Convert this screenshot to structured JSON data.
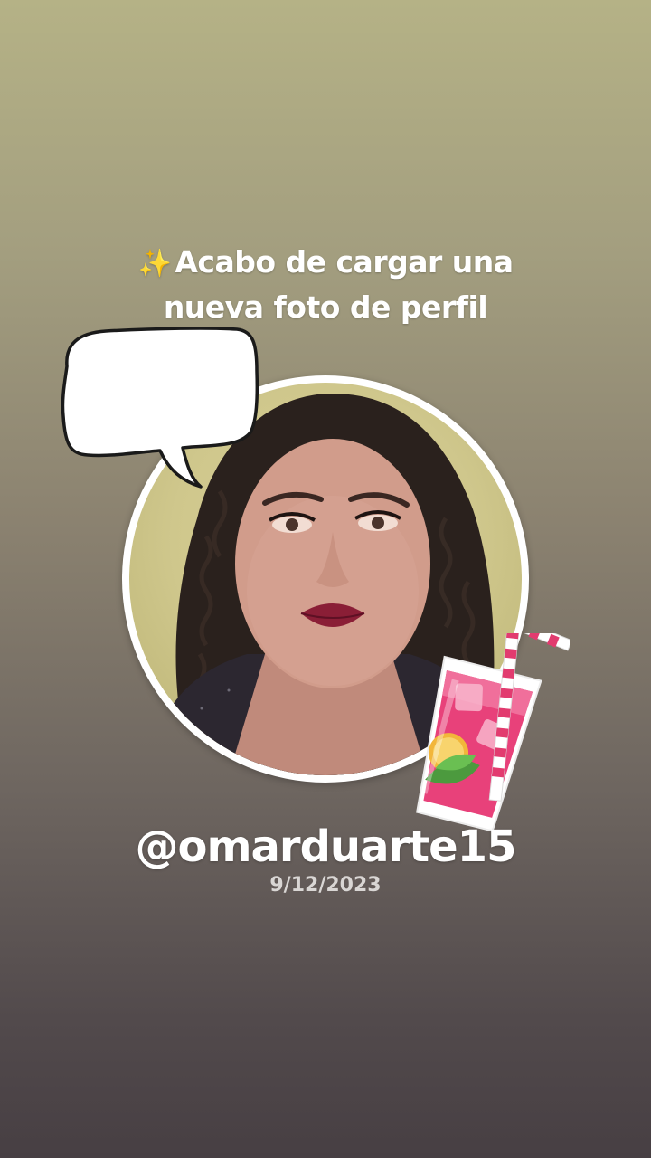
{
  "headline": {
    "emoji": "✨",
    "line1": "Acabo de cargar una",
    "line2": "nueva foto de perfil"
  },
  "profile": {
    "username": "@omarduarte15",
    "date": "9/12/2023",
    "photo_icon": "profile-photo"
  },
  "stickers": {
    "speech_bubble_icon": "speech-bubble-icon",
    "drink_icon": "pink-drink-icon"
  },
  "colors": {
    "background_top": "#b5b286",
    "background_bottom": "#473f43",
    "ring": "#ffffff",
    "drink_pink": "#e8417a",
    "straw_stripe": "#e23b6f"
  }
}
